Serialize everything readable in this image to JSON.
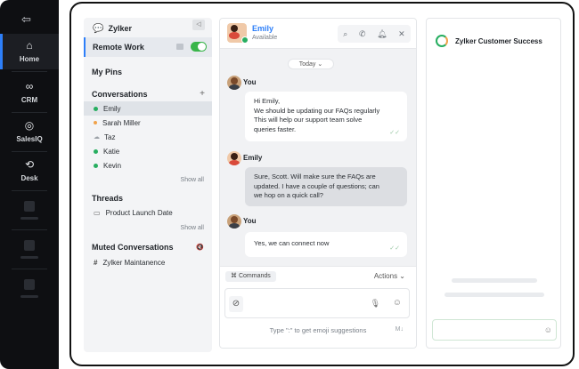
{
  "rail": {
    "items": [
      {
        "label": "Home",
        "icon": "home-icon"
      },
      {
        "label": "CRM",
        "icon": "crm-icon"
      },
      {
        "label": "SalesIQ",
        "icon": "salesiq-icon"
      },
      {
        "label": "Desk",
        "icon": "desk-icon"
      }
    ],
    "active": "Home"
  },
  "sidebar": {
    "app_name": "Zylker",
    "remote_work": "Remote Work",
    "my_pins": "My Pins",
    "conversations_title": "Conversations",
    "conversations": [
      {
        "name": "Emily",
        "status": "online"
      },
      {
        "name": "Sarah Miller",
        "status": "away"
      },
      {
        "name": "Taz",
        "status": "offline"
      },
      {
        "name": "Katie",
        "status": "online"
      },
      {
        "name": "Kevin",
        "status": "online"
      }
    ],
    "show_all": "Show all",
    "threads_title": "Threads",
    "threads": [
      "Product Launch Date"
    ],
    "muted_title": "Muted Conversations",
    "muted": [
      "Zylker Maintanence"
    ]
  },
  "chat": {
    "contact_name": "Emily",
    "contact_status": "Available",
    "date_label": "Today",
    "messages": [
      {
        "sender": "You",
        "lines": [
          "Hi Emily,",
          "We should be updating our FAQs regularly",
          "This will help our support team solve",
          "queries faster."
        ]
      },
      {
        "sender": "Emily",
        "lines": [
          "Sure, Scott. Will make sure the FAQs are",
          "updated. I have a couple of questions; can",
          "we hop on a quick call?"
        ]
      },
      {
        "sender": "You",
        "lines": [
          "Yes, we can connect now"
        ]
      }
    ],
    "commands_label": "Commands",
    "actions_label": "Actions",
    "hint": "Type \":\" to get emoji suggestions",
    "markdown": "M↓"
  },
  "right_panel": {
    "title": "Zylker Customer Success"
  },
  "colors": {
    "accent": "#2d7ff9",
    "online": "#27ae60",
    "away": "#f0a24a",
    "rail_bg": "#0e0f12"
  }
}
